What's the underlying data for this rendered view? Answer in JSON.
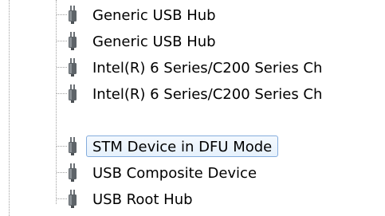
{
  "device_tree": {
    "selected_index": 4,
    "items": [
      {
        "label": "Generic USB Hub",
        "icon": "usb-connector-icon"
      },
      {
        "label": "Generic USB Hub",
        "icon": "usb-connector-icon"
      },
      {
        "label": "Intel(R) 6 Series/C200 Series Ch",
        "icon": "usb-connector-icon"
      },
      {
        "label": "Intel(R) 6 Series/C200 Series Ch",
        "icon": "usb-connector-icon"
      },
      {
        "label": "STM Device in DFU Mode",
        "icon": "usb-connector-icon"
      },
      {
        "label": "USB Composite Device",
        "icon": "usb-connector-icon"
      },
      {
        "label": "USB Root Hub",
        "icon": "usb-connector-icon"
      }
    ]
  },
  "colors": {
    "selection_border": "#84acdd",
    "selection_fill": "#e6f1fc",
    "tree_lines": "#a0a0a0",
    "icon": "#5e6469"
  }
}
